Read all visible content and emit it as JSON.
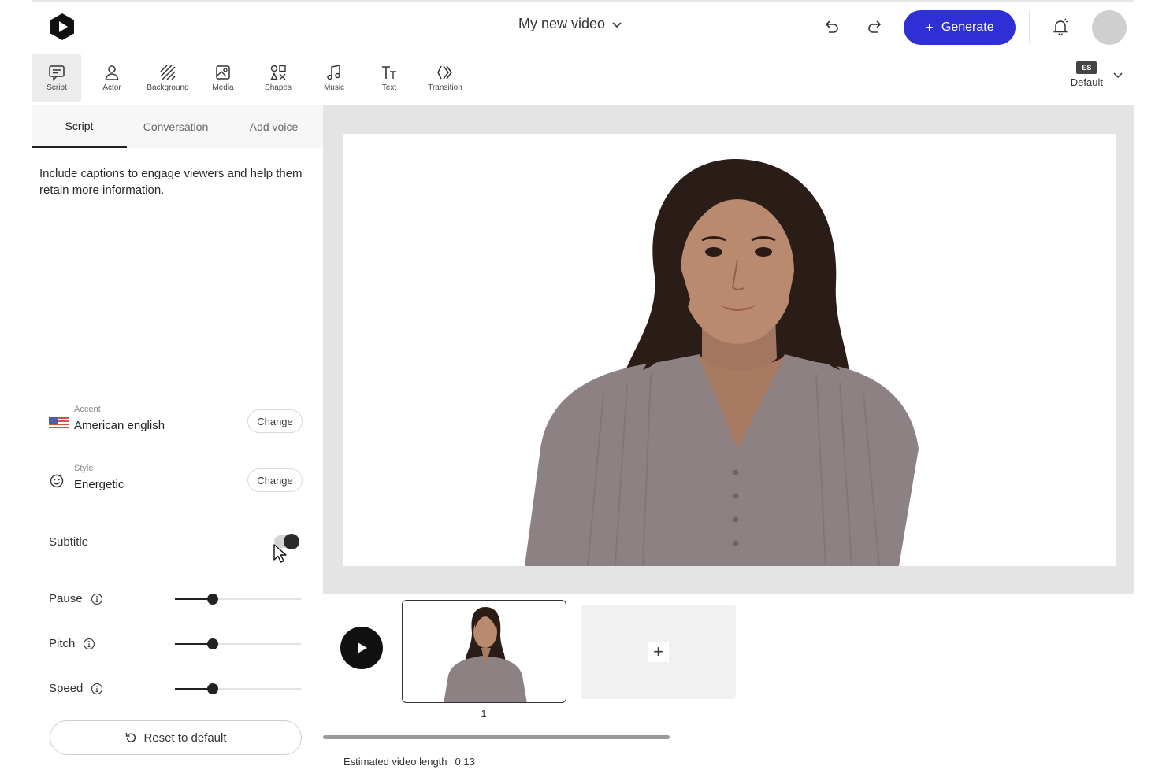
{
  "header": {
    "title": "My new video",
    "generate_label": "Generate",
    "accent_color": "#2f2fd6"
  },
  "toolbar": {
    "items": [
      {
        "label": "Script",
        "icon": "script-icon",
        "active": true
      },
      {
        "label": "Actor",
        "icon": "actor-icon"
      },
      {
        "label": "Background",
        "icon": "background-icon"
      },
      {
        "label": "Media",
        "icon": "media-icon"
      },
      {
        "label": "Shapes",
        "icon": "shapes-icon"
      },
      {
        "label": "Music",
        "icon": "music-icon"
      },
      {
        "label": "Text",
        "icon": "text-icon"
      },
      {
        "label": "Transition",
        "icon": "transition-icon"
      }
    ],
    "language_badge": "ES",
    "language_label": "Default"
  },
  "left_panel": {
    "tabs": [
      {
        "label": "Script",
        "active": true
      },
      {
        "label": "Conversation"
      },
      {
        "label": "Add voice"
      }
    ],
    "hint": "Include captions to engage viewers and help them retain more information.",
    "accent": {
      "caption": "Accent",
      "value": "American english",
      "button": "Change",
      "icon": "us-flag-icon"
    },
    "style": {
      "caption": "Style",
      "value": "Energetic",
      "button": "Change",
      "icon": "smiley-icon"
    },
    "subtitle": {
      "label": "Subtitle",
      "enabled": true
    },
    "sliders": [
      {
        "label": "Pause",
        "value": 0.3
      },
      {
        "label": "Pitch",
        "value": 0.3
      },
      {
        "label": "Speed",
        "value": 0.3
      }
    ],
    "reset_label": "Reset to default"
  },
  "timeline": {
    "scene_number": "1",
    "estimated_label": "Estimated video length",
    "estimated_value": "0:13"
  }
}
